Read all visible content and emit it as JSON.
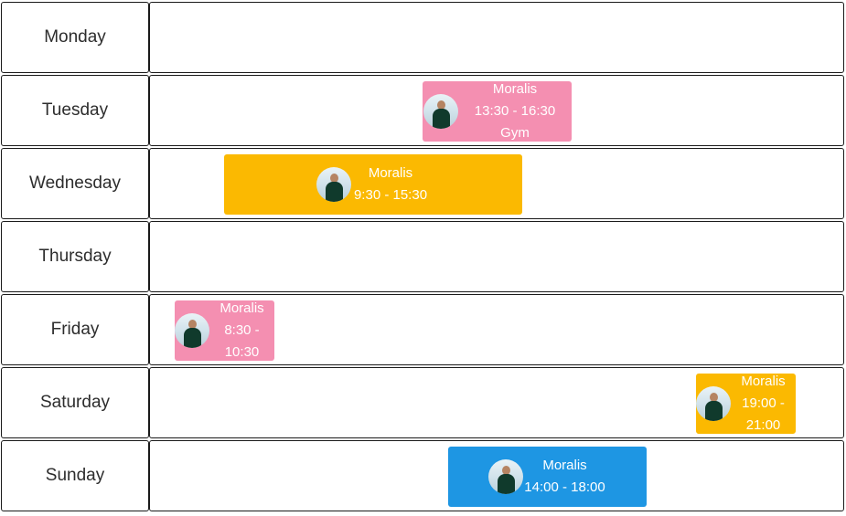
{
  "days": [
    {
      "label": "Monday"
    },
    {
      "label": "Tuesday"
    },
    {
      "label": "Wednesday"
    },
    {
      "label": "Thursday"
    },
    {
      "label": "Friday"
    },
    {
      "label": "Saturday"
    },
    {
      "label": "Sunday"
    }
  ],
  "events": [
    {
      "name": "Moralis",
      "time": "13:30 - 16:30",
      "note": "Gym",
      "color": "#f48fb1",
      "avatar_icon": "person-photo-icon"
    },
    {
      "name": "Moralis",
      "time": "9:30 - 15:30",
      "color": "#fbb901",
      "avatar_icon": "person-photo-icon"
    },
    {
      "name": "Moralis",
      "time": "8:30 - 10:30",
      "color": "#f48fb1",
      "avatar_icon": "person-photo-icon"
    },
    {
      "name": "Moralis",
      "time": "19:00 - 21:00",
      "color": "#fbb901",
      "avatar_icon": "person-photo-icon"
    },
    {
      "name": "Moralis",
      "time": "14:00 - 18:00",
      "color": "#1e96e3",
      "avatar_icon": "person-photo-icon"
    }
  ]
}
